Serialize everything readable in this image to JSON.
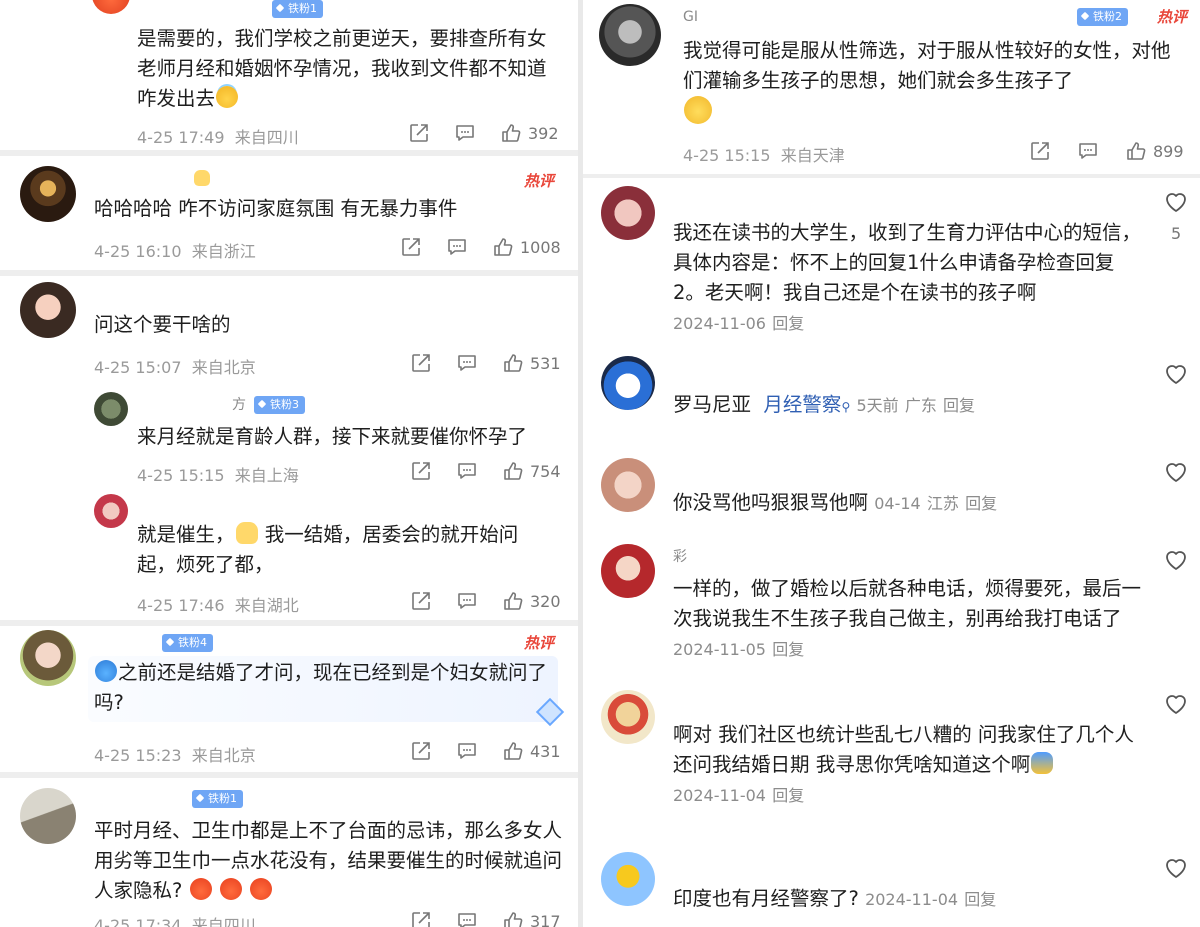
{
  "left": {
    "comments": [
      {
        "badge": "铁粉1",
        "text": "是需要的，我们学校之前更逆天，要排查所有女老师月经和婚姻怀孕情况，我收到文件都不知道咋发出去",
        "time": "4-25 17:49",
        "location": "来自四川",
        "likes": "392"
      },
      {
        "hot": "热评",
        "text": "哈哈哈哈 咋不访问家庭氛围 有无暴力事件",
        "time": "4-25 16:10",
        "location": "来自浙江",
        "likes": "1008"
      },
      {
        "text": "问这个要干啥的",
        "time": "4-25 15:07",
        "location": "来自北京",
        "likes": "531",
        "replies": [
          {
            "name": "方",
            "badge": "铁粉3",
            "text": "来月经就是育龄人群，接下来就要催你怀孕了",
            "time": "4-25 15:15",
            "location": "来自上海",
            "likes": "754"
          },
          {
            "text_a": "就是催生，",
            "text_b": "我一结婚，居委会的就开始问起，烦死了都，",
            "time": "4-25 17:46",
            "location": "来自湖北",
            "likes": "320"
          }
        ]
      },
      {
        "badge": "铁粉4",
        "hot": "热评",
        "text": "之前还是结婚了才问，现在已经到是个妇女就问了吗?",
        "time": "4-25 15:23",
        "location": "来自北京",
        "likes": "431"
      },
      {
        "badge": "铁粉1",
        "text": "平时月经、卫生巾都是上不了台面的忌讳，那么多女人用劣等卫生巾一点水花没有，结果要催生的时候就追问人家隐私?",
        "time": "4-25 17:34",
        "location": "来自四川",
        "likes": "317"
      }
    ]
  },
  "right": {
    "top": {
      "name": "GI",
      "badge": "铁粉2",
      "hot": "热评",
      "text": "我觉得可能是服从性筛选，对于服从性较好的女性，对他们灌输多生孩子的思想，她们就会多生孩子了",
      "time": "4-25 15:15",
      "location": "来自天津",
      "likes": "899"
    },
    "comments": [
      {
        "text": "我还在读书的大学生，收到了生育力评估中心的短信，具体内容是：怀不上的回复1什么申请备孕检查回复2。老天啊！我自己还是个在读书的孩子啊",
        "date": "2024-11-06",
        "reply": "回复",
        "likes": "5"
      },
      {
        "text": "罗马尼亚",
        "highlight": "月经警察",
        "date": "5天前",
        "location": "广东",
        "reply": "回复"
      },
      {
        "text": "你没骂他吗狠狠骂他啊",
        "date": "04-14",
        "location": "江苏",
        "reply": "回复"
      },
      {
        "name": "彩",
        "text": "一样的，做了婚检以后就各种电话，烦得要死，最后一次我说我生不生孩子我自己做主，别再给我打电话了",
        "date": "2024-11-05",
        "reply": "回复"
      },
      {
        "text": "啊对 我们社区也统计些乱七八糟的 问我家住了几个人 还问我结婚日期 我寻思你凭啥知道这个啊",
        "date": "2024-11-04",
        "reply": "回复"
      },
      {
        "text": "印度也有月经警察了?",
        "date": "2024-11-04",
        "reply": "回复"
      }
    ]
  }
}
